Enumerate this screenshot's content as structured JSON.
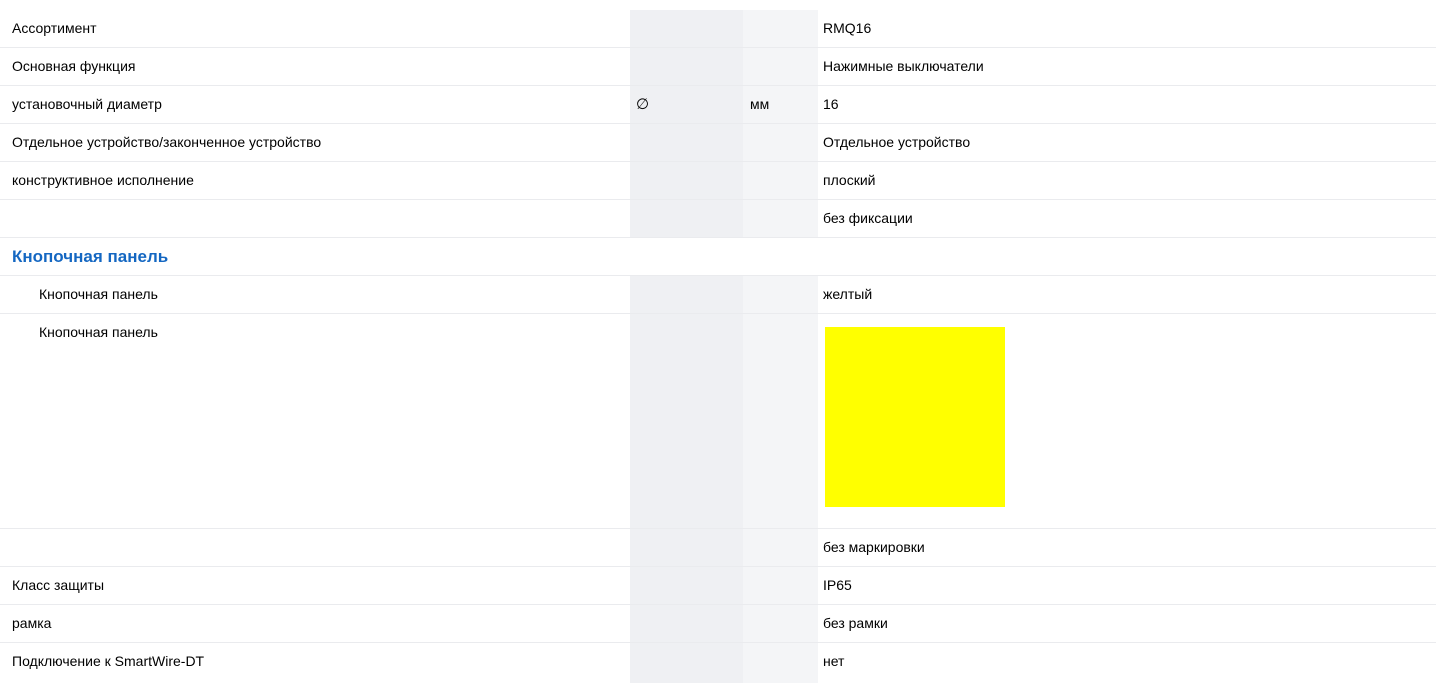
{
  "colors": {
    "accent": "#1467c2",
    "swatch": "#ffff00"
  },
  "rows": [
    {
      "label": "Ассортимент",
      "symbol": "",
      "unit": "",
      "value": "RMQ16"
    },
    {
      "label": "Основная функция",
      "symbol": "",
      "unit": "",
      "value": "Нажимные выключатели"
    },
    {
      "label": "установочный диаметр",
      "symbol": "∅",
      "unit": "мм",
      "value": "16"
    },
    {
      "label": "Отдельное устройство/законченное устройство",
      "symbol": "",
      "unit": "",
      "value": "Отдельное устройство"
    },
    {
      "label": "конструктивное исполнение",
      "symbol": "",
      "unit": "",
      "value": "плоский"
    },
    {
      "label": "",
      "symbol": "",
      "unit": "",
      "value": "без фиксации"
    }
  ],
  "section": {
    "title": "Кнопочная панель",
    "rows": [
      {
        "label": "Кнопочная панель",
        "value": "желтый"
      },
      {
        "label": "Кнопочная панель",
        "swatch_color_name": "yellow"
      }
    ]
  },
  "rows_after": [
    {
      "label": "",
      "value": "без маркировки"
    },
    {
      "label": "Класс защиты",
      "value": "IP65"
    },
    {
      "label": "рамка",
      "value": "без рамки"
    },
    {
      "label": "Подключение к SmartWire-DT",
      "value": "нет"
    }
  ]
}
